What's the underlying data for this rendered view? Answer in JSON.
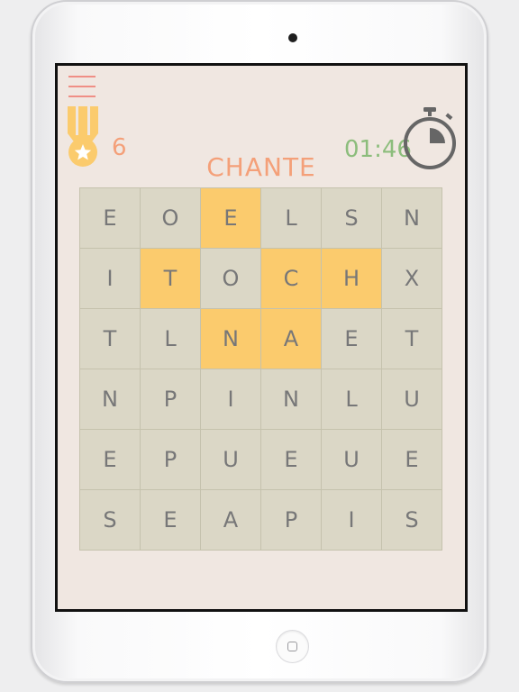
{
  "game": {
    "score": "6",
    "current_word": "CHANTE",
    "timer": "01:46",
    "stopwatch_fraction_elapsed": 0.25,
    "icons": {
      "menu": "hamburger-menu-icon",
      "medal": "medal-star-icon",
      "timer": "stopwatch-icon"
    },
    "colors": {
      "background": "#f0e7e1",
      "tile": "#dbd7c6",
      "tile_highlight": "#fbcb6d",
      "letter": "#777778",
      "word": "#f4a079",
      "timer": "#8cbd7c",
      "menu": "#ef8f86"
    }
  },
  "grid": {
    "rows": [
      [
        "E",
        "O",
        "E",
        "L",
        "S",
        "N"
      ],
      [
        "I",
        "T",
        "O",
        "C",
        "H",
        "X"
      ],
      [
        "T",
        "L",
        "N",
        "A",
        "E",
        "T"
      ],
      [
        "N",
        "P",
        "I",
        "N",
        "L",
        "U"
      ],
      [
        "E",
        "P",
        "U",
        "E",
        "U",
        "E"
      ],
      [
        "S",
        "E",
        "A",
        "P",
        "I",
        "S"
      ]
    ],
    "highlighted": [
      [
        0,
        2
      ],
      [
        1,
        1
      ],
      [
        1,
        3
      ],
      [
        1,
        4
      ],
      [
        2,
        2
      ],
      [
        2,
        3
      ]
    ]
  }
}
